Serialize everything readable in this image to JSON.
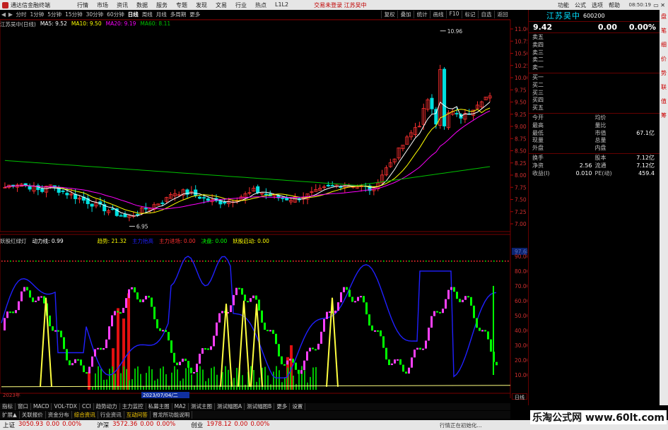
{
  "titlebar": {
    "app_title": "通达信金融终端",
    "menus": [
      "行情",
      "市场",
      "资讯",
      "数据",
      "服务",
      "专题",
      "发现",
      "文易",
      "行业",
      "热点",
      "L1L2"
    ],
    "center_info": "交易未登录   江苏吴中",
    "right_menus": [
      "功能",
      "公式",
      "选项",
      "帮助"
    ],
    "clock": "08:50:19",
    "restore": "▭ ✕"
  },
  "toolbar": {
    "periods": [
      "分时",
      "1分钟",
      "5分钟",
      "15分钟",
      "30分钟",
      "60分钟",
      "日线",
      "周线",
      "月线",
      "多周期",
      "更多"
    ],
    "active_period": "日线",
    "right_tools": [
      "复权",
      "叠加",
      "统计",
      "画线",
      "F10",
      "标记",
      "自选",
      "返回"
    ]
  },
  "main_chart": {
    "info": {
      "name": "江苏吴中(日线)",
      "ma5": "MA5: 9.52",
      "ma10": "MA10: 9.50",
      "ma20": "MA20: 9.19",
      "ma60": "MA60: 8.11"
    },
    "y_ticks": [
      "11.00",
      "10.75",
      "10.50",
      "10.25",
      "10.00",
      "9.75",
      "9.50",
      "9.25",
      "9.00",
      "8.75",
      "8.50",
      "8.25",
      "8.00",
      "7.75",
      "7.50",
      "7.25",
      "7.00"
    ],
    "high_label": "10.96",
    "low_label": "6.95"
  },
  "indicator": {
    "info": {
      "name": "妖股红绿灯",
      "power": "动力线: 0.99",
      "trend": "趋势: 21.32",
      "main": "主力抬高",
      "inflow": "主力进场: 0.00",
      "pos": "决盘: 0.00",
      "launch": "妖股启动: 0.00"
    },
    "y_ticks": [
      "97.68",
      "90.00",
      "80.00",
      "70.00",
      "60.00",
      "50.00",
      "40.00",
      "30.00",
      "20.00",
      "10.00"
    ],
    "date_label": "2023/07/04/二",
    "year_label": "2023年"
  },
  "right_panel": {
    "stock_name": "江苏吴中",
    "stock_code": "600200",
    "price": "9.42",
    "change": "0.00",
    "change_pct": "0.00%",
    "orderbook": [
      "卖五",
      "卖四",
      "卖三",
      "卖二",
      "卖一",
      "买一",
      "买二",
      "买三",
      "买四",
      "买五"
    ],
    "stats": [
      [
        {
          "k": "今开",
          "v": ""
        },
        {
          "k": "均价",
          "v": ""
        }
      ],
      [
        {
          "k": "最高",
          "v": ""
        },
        {
          "k": "量比",
          "v": ""
        }
      ],
      [
        {
          "k": "最低",
          "v": ""
        },
        {
          "k": "市值",
          "v": "67.1亿"
        }
      ],
      [
        {
          "k": "现量",
          "v": ""
        },
        {
          "k": "总量",
          "v": ""
        }
      ],
      [
        {
          "k": "外盘",
          "v": ""
        },
        {
          "k": "内盘",
          "v": ""
        }
      ]
    ],
    "stats2": [
      [
        {
          "k": "换手",
          "v": ""
        },
        {
          "k": "股本",
          "v": "7.12亿"
        }
      ],
      [
        {
          "k": "净资",
          "v": "2.56"
        },
        {
          "k": "流通",
          "v": "7.12亿"
        }
      ],
      [
        {
          "k": "收益(I)",
          "v": "0.010"
        },
        {
          "k": "PE(动)",
          "v": "459.4"
        }
      ]
    ]
  },
  "far_right_tabs": [
    "盘",
    "笔",
    "细",
    "价",
    "势",
    "联",
    "值",
    "筹"
  ],
  "axis_label_daily": "日线",
  "tabbar1": [
    "指标",
    "窗口",
    "MACD",
    "VOL-TDX",
    "CCI",
    "趋势动力",
    "主力监控",
    "私募主图",
    "MA2",
    "测试主图",
    "测试幅图A",
    "测试幅图B",
    "更多",
    "设置"
  ],
  "tabbar2": [
    "扩展▲",
    "关联报价",
    "资金分布",
    "综合资讯",
    "行业资讯",
    "互动问答",
    "晋龙所功能说明"
  ],
  "tabbar2_highlight": [
    "综合资讯",
    "互动问答"
  ],
  "statusbar": {
    "indices": [
      {
        "name": "上证",
        "value": "3050.93",
        "change": "0.00",
        "pct": "0.00%"
      },
      {
        "name": "沪深",
        "value": "3572.36",
        "change": "0.00",
        "pct": "0.00%"
      },
      {
        "name": "创业",
        "value": "1978.12",
        "change": "0.00",
        "pct": "0.00%"
      }
    ],
    "message": "行情正在初始化..."
  },
  "watermark": "乐淘公式网 www.60lt.com",
  "colors": {
    "up": "#ff3030",
    "down": "#00e0e0",
    "ma5": "#ffffff",
    "ma10": "#ffff00",
    "ma20": "#ff00ff",
    "ma60": "#00c000",
    "blue_line": "#2020ff",
    "magenta": "#ff40ff",
    "green": "#00ff00",
    "yellow": "#ffff40"
  }
}
